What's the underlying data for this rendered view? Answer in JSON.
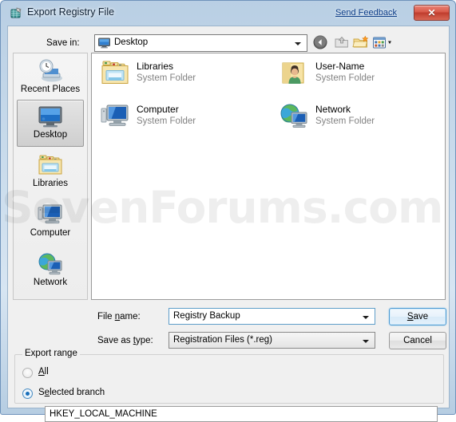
{
  "window": {
    "title": "Export Registry File",
    "title_icon": "registry-editor-icon",
    "send_feedback": "Send Feedback",
    "close_glyph": "✕"
  },
  "toolbar": {
    "save_in_label": "Save in:",
    "save_in_value": "Desktop",
    "save_in_icon": "desktop-monitor-icon",
    "buttons": [
      {
        "name": "back-button",
        "icon": "back-arrow-icon"
      },
      {
        "name": "up-one-level-button",
        "icon": "up-folder-icon"
      },
      {
        "name": "new-folder-button",
        "icon": "new-folder-icon"
      },
      {
        "name": "views-button",
        "icon": "views-grid-icon"
      }
    ]
  },
  "places": {
    "items": [
      {
        "label": "Recent Places",
        "icon": "recent-places-icon",
        "selected": false
      },
      {
        "label": "Desktop",
        "icon": "desktop-monitor-icon",
        "selected": true
      },
      {
        "label": "Libraries",
        "icon": "libraries-folder-icon",
        "selected": false
      },
      {
        "label": "Computer",
        "icon": "computer-monitor-icon",
        "selected": false
      },
      {
        "label": "Network",
        "icon": "network-globe-icon",
        "selected": false
      }
    ]
  },
  "filelist": {
    "items": [
      {
        "name": "Libraries",
        "type": "System Folder",
        "icon": "libraries-folder-icon"
      },
      {
        "name": "User-Name",
        "type": "System Folder",
        "icon": "user-folder-icon"
      },
      {
        "name": "Computer",
        "type": "System Folder",
        "icon": "computer-monitor-icon"
      },
      {
        "name": "Network",
        "type": "System Folder",
        "icon": "network-globe-icon"
      }
    ]
  },
  "fields": {
    "file_name_label": "File name:",
    "file_name_value": "Registry Backup",
    "save_as_type_label": "Save as type:",
    "save_as_type_value": "Registration Files (*.reg)"
  },
  "buttons": {
    "save": "Save",
    "cancel": "Cancel"
  },
  "export_range": {
    "legend": "Export range",
    "options": [
      {
        "label": "All",
        "selected": false
      },
      {
        "label": "Selected branch",
        "selected": true
      }
    ],
    "branch_value": "HKEY_LOCAL_MACHINE"
  },
  "watermark": "SevenForums.com",
  "colors": {
    "frame": "#b9cfe4",
    "accent_blue": "#1a6fba",
    "link": "#0b3c87",
    "close_red": "#bf3c2d",
    "subtext_gray": "#828282"
  }
}
